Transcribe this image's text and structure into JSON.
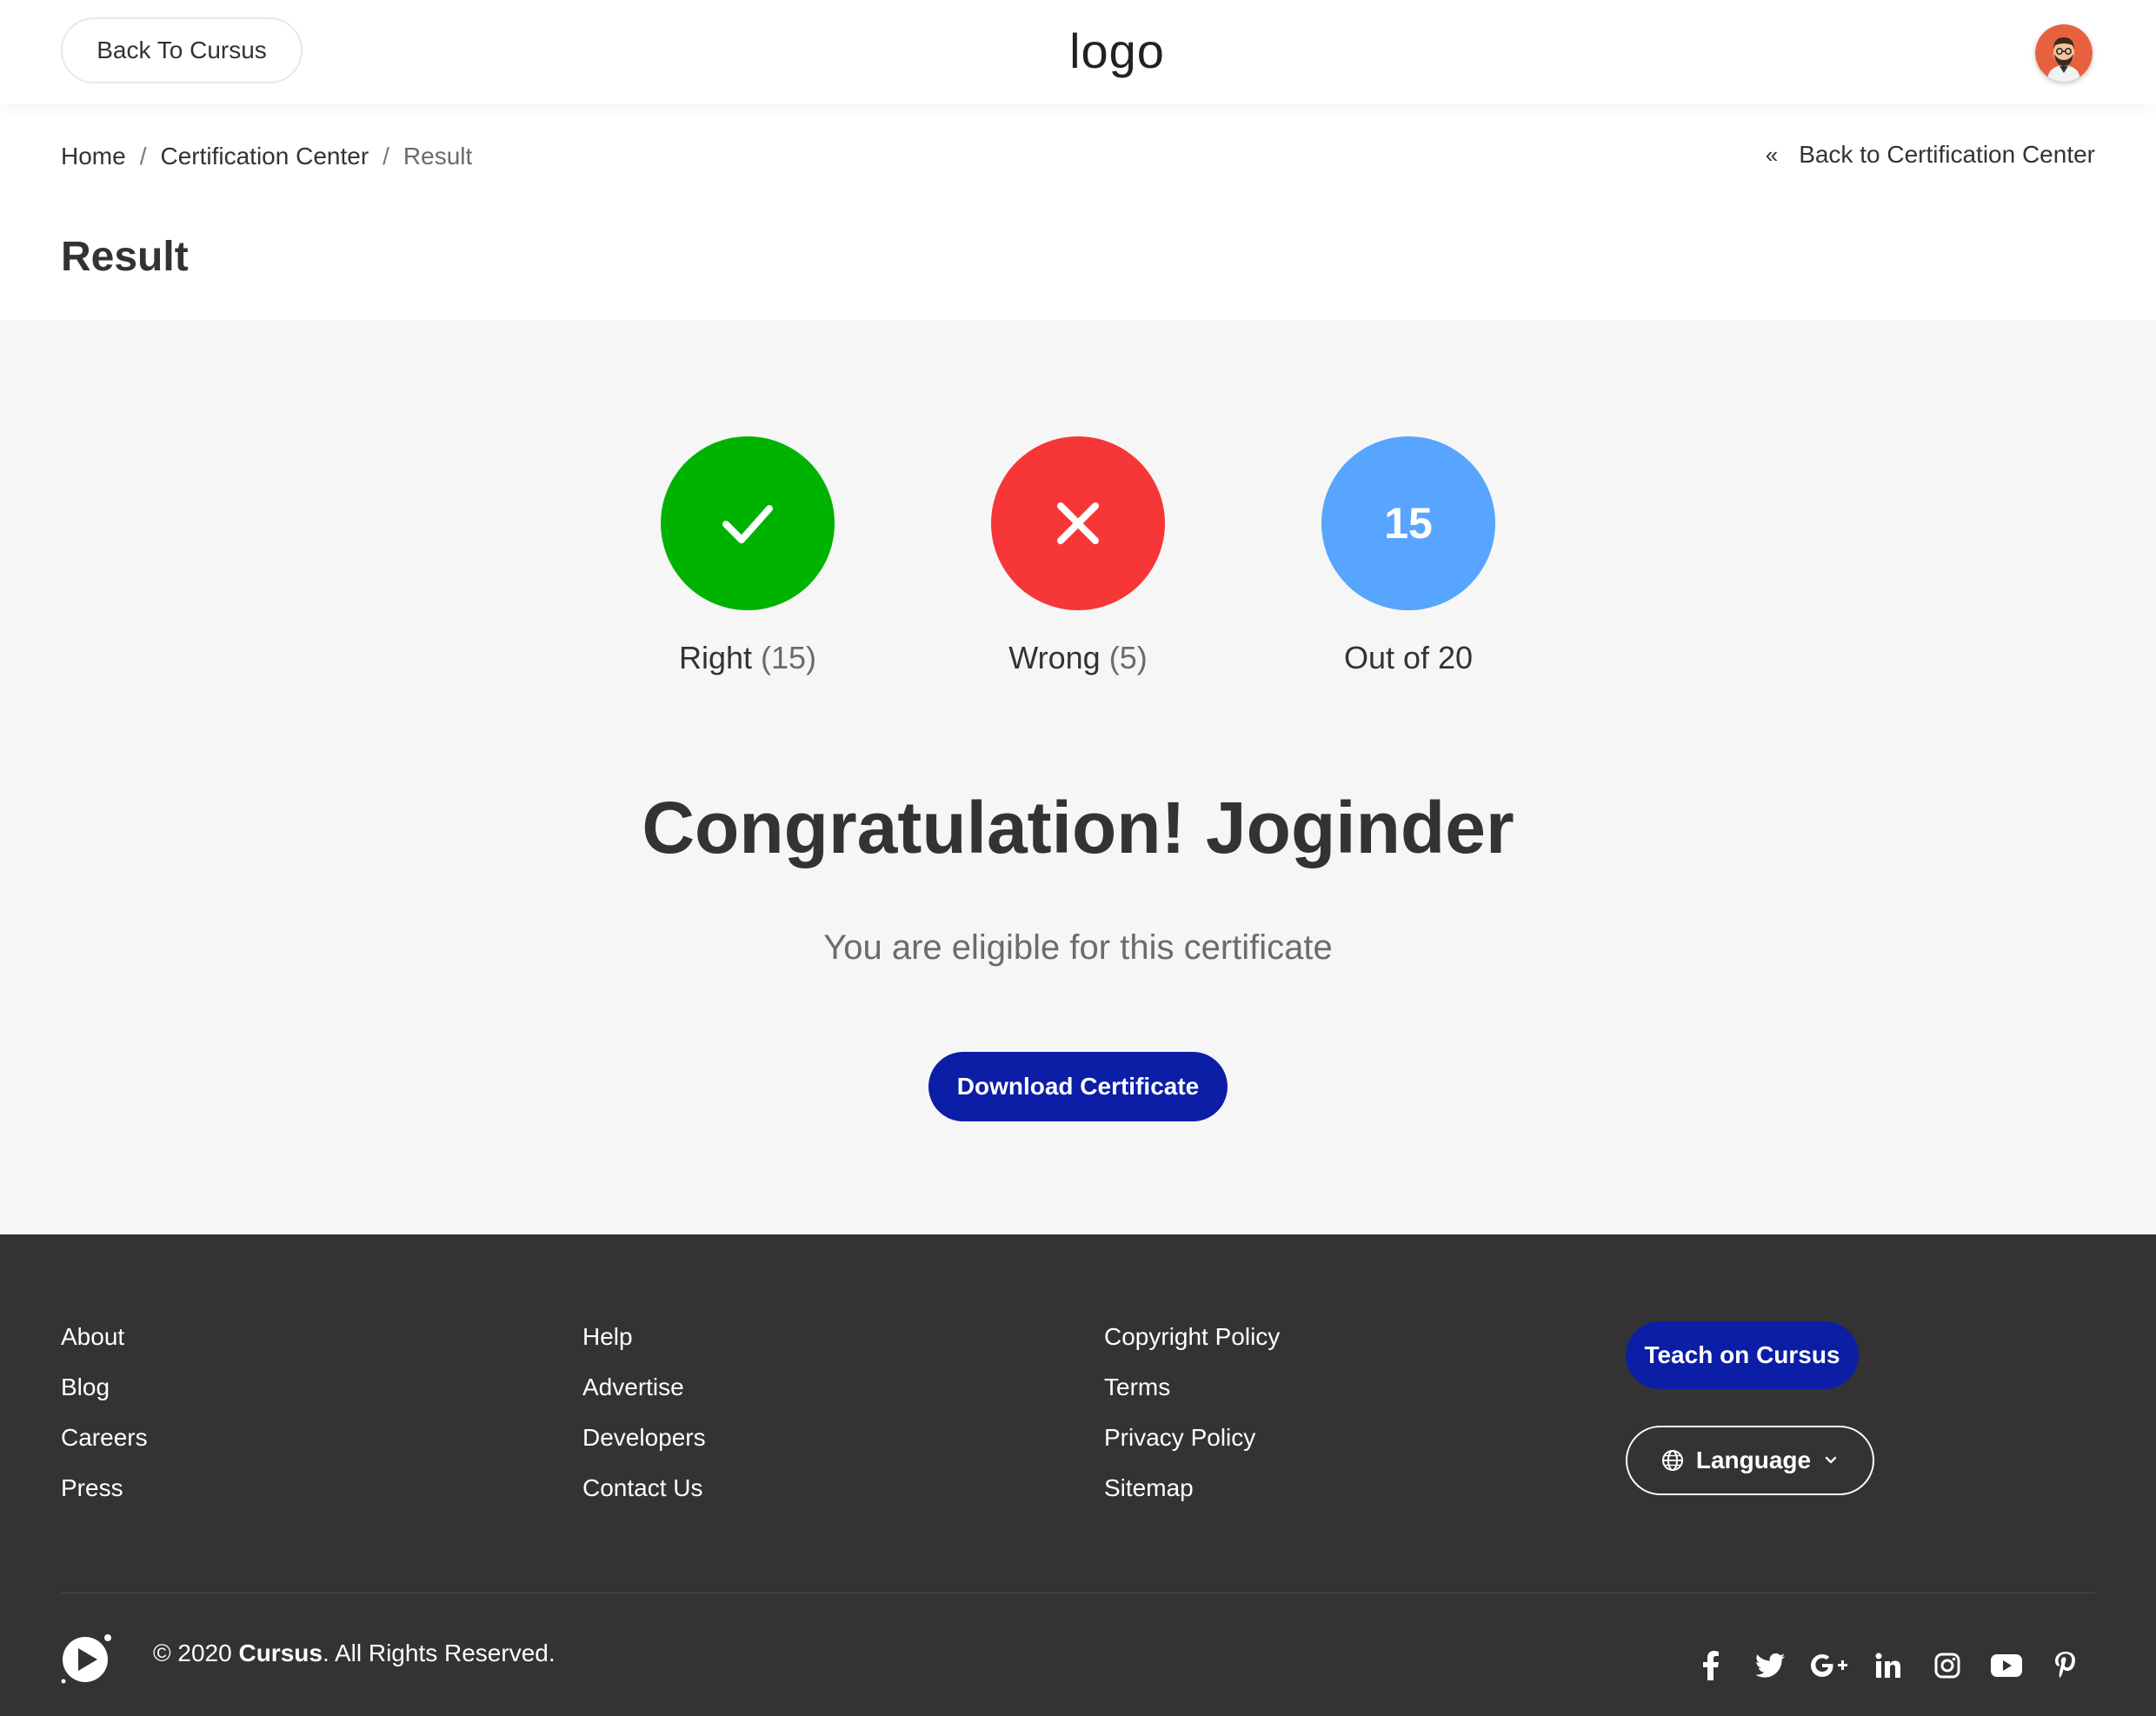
{
  "header": {
    "back_label": "Back To Cursus",
    "logo_text": "logo"
  },
  "breadcrumb": {
    "items": [
      "Home",
      "Certification Center",
      "Result"
    ],
    "separator": "/"
  },
  "back_link": {
    "chevron": "«",
    "label": "Back to Certification Center"
  },
  "page_title": "Result",
  "result": {
    "right": {
      "label": "Right",
      "count": "(15)",
      "color": "#00b300",
      "icon": "check-icon"
    },
    "wrong": {
      "label": "Wrong",
      "count": "(5)",
      "color": "#f73737",
      "icon": "close-icon"
    },
    "score": {
      "value": "15",
      "label": "Out of 20",
      "color": "#58a5ff"
    },
    "congrats": "Congratulation! Joginder",
    "subtitle": "You are eligible for this certificate",
    "download_label": "Download Certificate"
  },
  "footer": {
    "col1": [
      "About",
      "Blog",
      "Careers",
      "Press"
    ],
    "col2": [
      "Help",
      "Advertise",
      "Developers",
      "Contact Us"
    ],
    "col3": [
      "Copyright Policy",
      "Terms",
      "Privacy Policy",
      "Sitemap"
    ],
    "teach_label": "Teach on Cursus",
    "language_label": "Language",
    "copyright_prefix": "© 2020 ",
    "copyright_brand": "Cursus",
    "copyright_suffix": ". All Rights Reserved.",
    "socials": [
      "facebook-icon",
      "twitter-icon",
      "google-plus-icon",
      "linkedin-icon",
      "instagram-icon",
      "youtube-icon",
      "pinterest-icon"
    ]
  },
  "colors": {
    "primary": "#0c1ea6",
    "footer_bg": "#333333",
    "main_bg": "#f6f6f6"
  }
}
